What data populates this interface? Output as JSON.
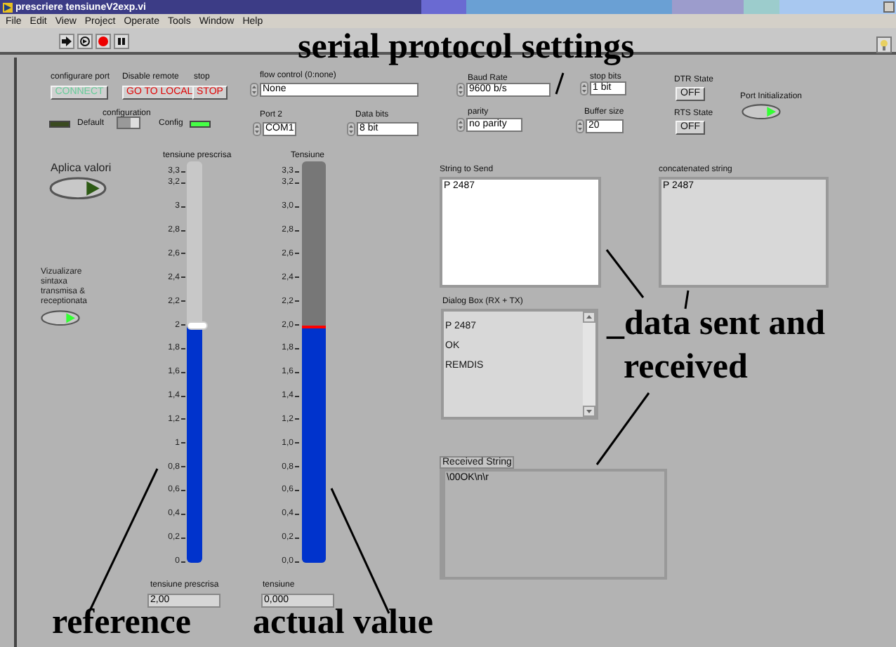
{
  "window": {
    "title": "prescriere tensiuneV2exp.vi"
  },
  "menu": [
    "File",
    "Edit",
    "View",
    "Project",
    "Operate",
    "Tools",
    "Window",
    "Help"
  ],
  "serial": {
    "configure_port": {
      "label": "configurare port",
      "button": "CONNECT"
    },
    "disable_remote": {
      "label": "Disable remote",
      "button": "GO TO LOCAL"
    },
    "stop": {
      "label": "stop",
      "button": "STOP"
    },
    "configuration": {
      "label": "configuration",
      "off_label": "Default",
      "on_label": "Config",
      "on": true
    },
    "flow_control": {
      "label": "flow control (0:none)",
      "value": "None"
    },
    "port": {
      "label": "Port 2",
      "value": "COM1"
    },
    "data_bits": {
      "label": "Data bits",
      "value": "8 bit"
    },
    "baud_rate": {
      "label": "Baud Rate",
      "value": "9600 b/s"
    },
    "stop_bits": {
      "label": "stop bits",
      "value": "1 bit"
    },
    "parity": {
      "label": "parity",
      "value": "no parity"
    },
    "buffer_size": {
      "label": "Buffer size",
      "value": "20"
    },
    "dtr": {
      "label": "DTR State",
      "button": "OFF",
      "on": false
    },
    "rts": {
      "label": "RTS State",
      "button": "OFF",
      "on": false
    },
    "port_init": {
      "label": "Port Initialization",
      "on": true
    }
  },
  "apply": {
    "label": "Aplica valori",
    "on": false
  },
  "show_syntax": {
    "label": "Vizualizare sintaxa transmisa & receptionata",
    "on": true
  },
  "reference": {
    "label": "tensiune prescrisa",
    "level": 0.606,
    "ticks": [
      "3,3",
      "3,2",
      "3",
      "2,8",
      "2,6",
      "2,4",
      "2,2",
      "2",
      "1,8",
      "1,6",
      "1,4",
      "1,2",
      "1",
      "0,8",
      "0,6",
      "0,4",
      "0,2",
      "0"
    ],
    "readout_label": "tensiune prescrisa",
    "readout": "2,00"
  },
  "actual": {
    "label": "Tensiune",
    "level": 0.606,
    "ticks": [
      "3,3",
      "3,2",
      "3,0",
      "2,8",
      "2,6",
      "2,4",
      "2,2",
      "2,0",
      "1,8",
      "1,6",
      "1,4",
      "1,2",
      "1,0",
      "0,8",
      "0,6",
      "0,4",
      "0,2",
      "0,0"
    ],
    "readout_label": "tensiune",
    "readout": "0,000"
  },
  "strings": {
    "to_send": {
      "label": "String to Send",
      "value": "P 2487"
    },
    "concatenated": {
      "label": "concatenated string",
      "value": "P 2487"
    },
    "dialog": {
      "label": "Dialog Box (RX + TX)",
      "lines": [
        "P 2487",
        "OK",
        "REMDIS"
      ]
    },
    "received": {
      "label": "Received String",
      "value": "\\00OK\\n\\r"
    }
  },
  "annotations": [
    {
      "text": "serial protocol settings"
    },
    {
      "text": "_data sent and received"
    },
    {
      "text": "reference"
    },
    {
      "text": "actual value"
    }
  ]
}
